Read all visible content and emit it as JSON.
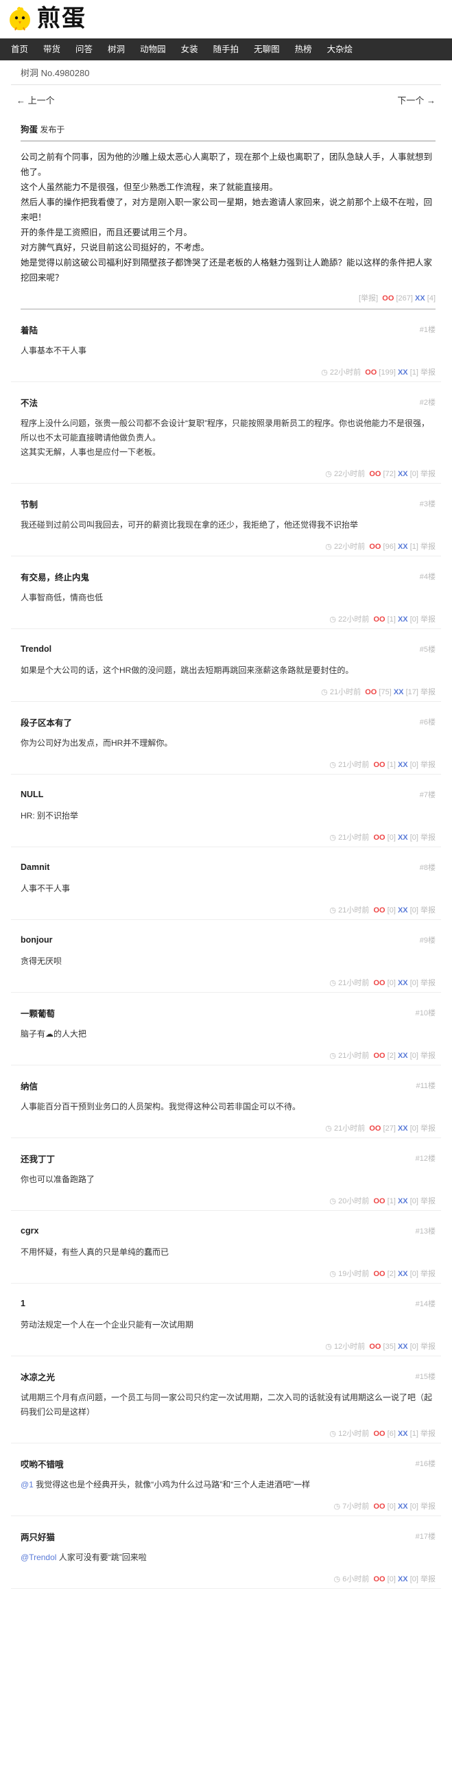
{
  "site": {
    "name": "煎蛋"
  },
  "nav": [
    "首页",
    "带货",
    "问答",
    "树洞",
    "动物园",
    "女装",
    "随手拍",
    "无聊图",
    "热榜",
    "大杂烩"
  ],
  "treehole": {
    "number_label": "树洞 No.4980280"
  },
  "pager": {
    "prev": "← 上一个",
    "next": "下一个 →"
  },
  "post": {
    "author": "狗蛋",
    "published": "发布于",
    "paragraphs": [
      "公司之前有个同事，因为他的沙雕上级太恶心人离职了，现在那个上级也离职了，团队急缺人手，人事就想到他了。",
      "这个人虽然能力不是很强，但至少熟悉工作流程，来了就能直接用。",
      "然后人事的操作把我看傻了，对方是刚入职一家公司一星期，她去邀请人家回来，说之前那个上级不在啦，回来吧！",
      "开的条件是工资照旧，而且还要试用三个月。",
      "对方脾气真好，只说目前这公司挺好的，不考虑。",
      "她是觉得以前这破公司福利好到隔壁孩子都馋哭了还是老板的人格魅力强到让人跪舔？能以这样的条件把人家挖回来呢？"
    ],
    "report": "[举报]",
    "oo": "OO",
    "oo_count": "[267]",
    "xx": "XX",
    "xx_count": "[4]"
  },
  "comments": [
    {
      "name": "着陆",
      "floor": "#1楼",
      "text": "人事基本不干人事",
      "time": "22小时前",
      "oo": "[199]",
      "xx": "[1]"
    },
    {
      "name": "不法",
      "floor": "#2楼",
      "text": "程序上没什么问题，张贵一般公司都不会设计“复职”程序，只能按照录用新员工的程序。你也说他能力不是很强，所以也不太可能直接聘请他做负责人。\n这其实无解，人事也是应付一下老板。",
      "time": "22小时前",
      "oo": "[72]",
      "xx": "[0]"
    },
    {
      "name": "节制",
      "floor": "#3楼",
      "text": "我还碰到过前公司叫我回去，可开的薪资比我现在拿的还少，我拒绝了，他还觉得我不识抬举",
      "time": "22小时前",
      "oo": "[96]",
      "xx": "[1]"
    },
    {
      "name": "有交易，终止内鬼",
      "floor": "#4楼",
      "text": "人事智商低，情商也低",
      "time": "22小时前",
      "oo": "[1]",
      "xx": "[0]"
    },
    {
      "name": "Trendol",
      "floor": "#5楼",
      "text": "如果是个大公司的话，这个HR做的没问题，跳出去短期再跳回来涨薪这条路就是要封住的。",
      "time": "21小时前",
      "oo": "[75]",
      "xx": "[17]"
    },
    {
      "name": "段子区本有了",
      "floor": "#6楼",
      "text": "你为公司好为出发点，而HR并不理解你。",
      "time": "21小时前",
      "oo": "[1]",
      "xx": "[0]"
    },
    {
      "name": "NULL",
      "floor": "#7楼",
      "text": "HR: 别不识抬举",
      "time": "21小时前",
      "oo": "[0]",
      "xx": "[0]"
    },
    {
      "name": "Damnit",
      "floor": "#8楼",
      "text": "人事不干人事",
      "time": "21小时前",
      "oo": "[0]",
      "xx": "[0]"
    },
    {
      "name": "bonjour",
      "floor": "#9楼",
      "text": "贪得无厌呗",
      "time": "21小时前",
      "oo": "[0]",
      "xx": "[0]"
    },
    {
      "name": "一颗葡萄",
      "floor": "#10楼",
      "text": "脑子有☁的人大把",
      "time": "21小时前",
      "oo": "[2]",
      "xx": "[0]"
    },
    {
      "name": "纳信",
      "floor": "#11楼",
      "text": "人事能百分百干预到业务口的人员架构。我觉得这种公司若非国企可以不待。",
      "time": "21小时前",
      "oo": "[27]",
      "xx": "[0]"
    },
    {
      "name": "还我丁丁",
      "floor": "#12楼",
      "text": "你也可以准备跑路了",
      "time": "20小时前",
      "oo": "[1]",
      "xx": "[0]"
    },
    {
      "name": "cgrx",
      "floor": "#13楼",
      "text": "不用怀疑，有些人真的只是单纯的蠢而已",
      "time": "19小时前",
      "oo": "[2]",
      "xx": "[0]"
    },
    {
      "name": "1",
      "floor": "#14楼",
      "text": "劳动法规定一个人在一个企业只能有一次试用期",
      "time": "12小时前",
      "oo": "[35]",
      "xx": "[0]"
    },
    {
      "name": "冰凉之光",
      "floor": "#15楼",
      "text": "试用期三个月有点问题，一个员工与同一家公司只约定一次试用期，二次入司的话就没有试用期这么一说了吧（起码我们公司是这样）",
      "time": "12小时前",
      "oo": "[6]",
      "xx": "[1]"
    },
    {
      "name": "哎哟不错哦",
      "floor": "#16楼",
      "text_at": "@1",
      "text": " 我觉得这也是个经典开头，就像“小鸡为什么过马路”和“三个人走进酒吧”一样",
      "time": "7小时前",
      "oo": "[0]",
      "xx": "[0]"
    },
    {
      "name": "两只好猫",
      "floor": "#17楼",
      "text_at": "@Trendol",
      "text": " 人家可没有要“跳”回来啦",
      "time": "6小时前",
      "oo": "[0]",
      "xx": "[0]"
    }
  ],
  "labels": {
    "oo": "OO",
    "xx": "XX",
    "report": "举报",
    "clock": "◷"
  },
  "colors": {
    "nav_bg": "#2f2f2f",
    "oo": "#e44444",
    "xx": "#5a7bd8",
    "logo_yellow": "#ffd400"
  }
}
